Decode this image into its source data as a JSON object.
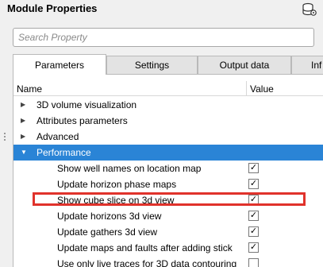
{
  "header": {
    "title": "Module Properties"
  },
  "search": {
    "placeholder": "Search Property"
  },
  "tabs": [
    {
      "label": "Parameters",
      "active": true
    },
    {
      "label": "Settings"
    },
    {
      "label": "Output data"
    },
    {
      "label": "Inf"
    }
  ],
  "table": {
    "columns": {
      "name": "Name",
      "value": "Value"
    },
    "groups": [
      {
        "label": "3D volume visualization",
        "expanded": false
      },
      {
        "label": "Attributes parameters",
        "expanded": false
      },
      {
        "label": "Advanced",
        "expanded": false
      },
      {
        "label": "Performance",
        "expanded": true
      }
    ],
    "properties": [
      {
        "label": "Show well names on location map",
        "checked": true
      },
      {
        "label": "Update horizon phase maps",
        "checked": true
      },
      {
        "label": "Show cube slice on 3d view",
        "checked": true
      },
      {
        "label": "Update horizons 3d view",
        "checked": true
      },
      {
        "label": "Update gathers 3d view",
        "checked": true
      },
      {
        "label": "Update maps and faults after adding stick",
        "checked": true
      },
      {
        "label": "Use only live traces for 3D data contouring",
        "checked": false
      }
    ]
  },
  "colors": {
    "selection": "#2a84d6",
    "highlight_box": "#e0322b"
  },
  "icons": {
    "toolbar": "database-settings-icon"
  }
}
